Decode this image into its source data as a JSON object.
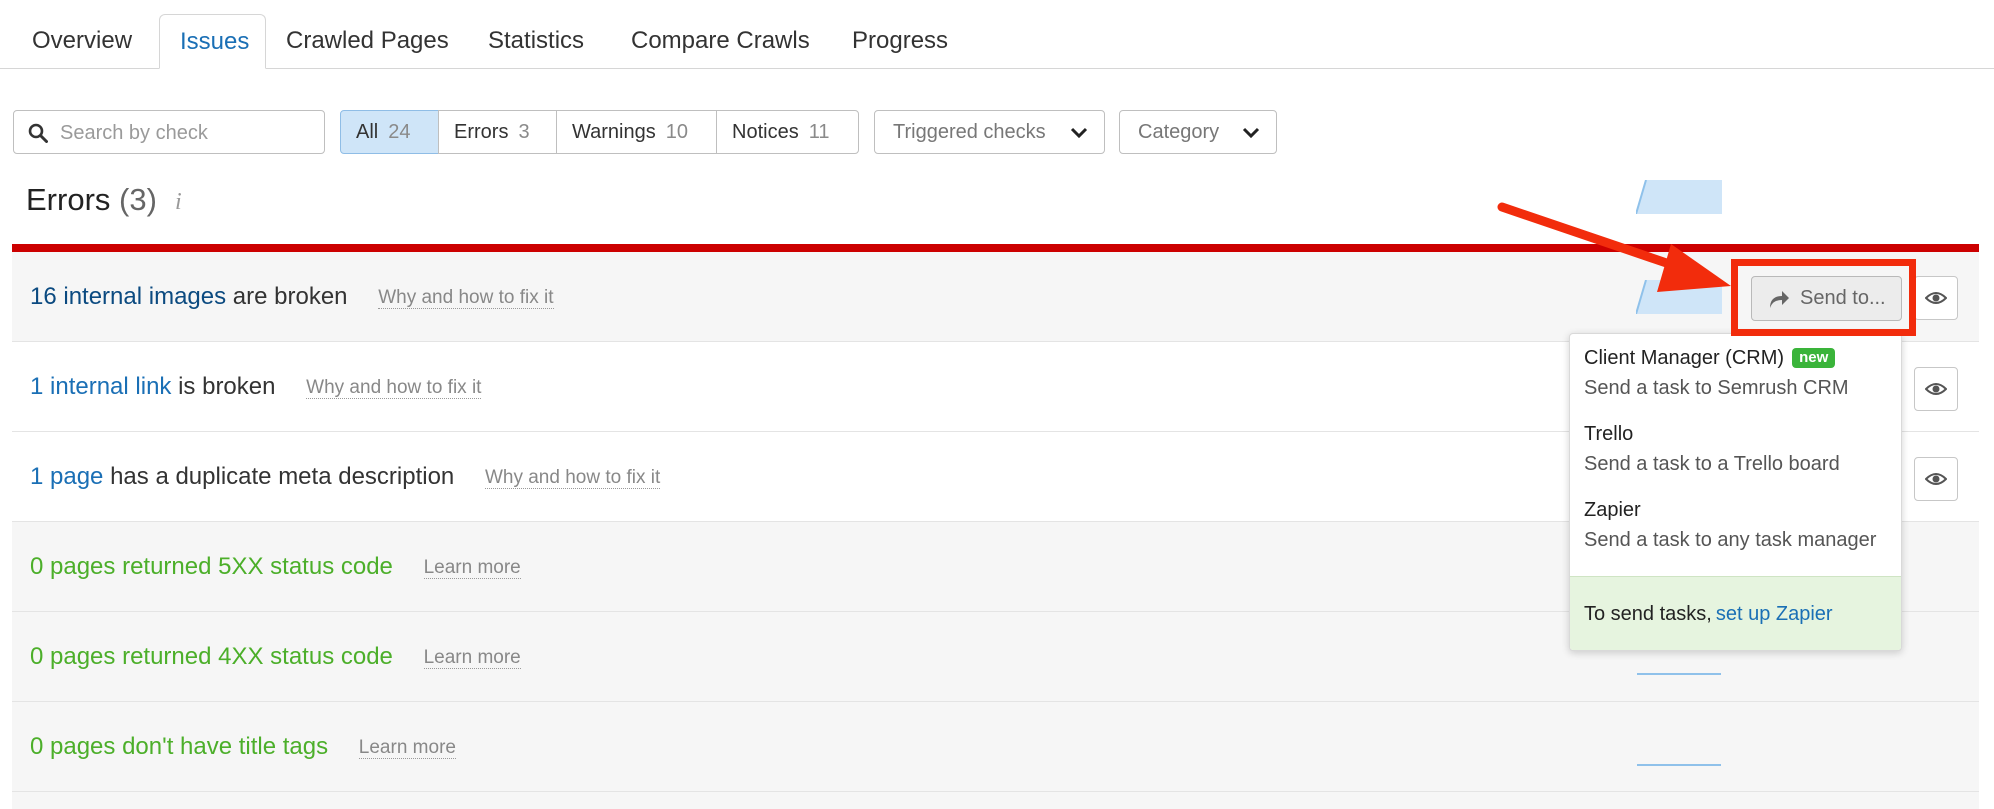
{
  "tabs": [
    "Overview",
    "Issues",
    "Crawled Pages",
    "Statistics",
    "Compare Crawls",
    "Progress"
  ],
  "active_tab": "Issues",
  "search": {
    "placeholder": "Search by check"
  },
  "filters": [
    {
      "label": "All",
      "count": "24",
      "active": true
    },
    {
      "label": "Errors",
      "count": "3"
    },
    {
      "label": "Warnings",
      "count": "10"
    },
    {
      "label": "Notices",
      "count": "11"
    }
  ],
  "dropdowns": {
    "triggered": "Triggered checks",
    "category": "Category"
  },
  "section": {
    "title": "Errors",
    "count": "(3)",
    "info": "i"
  },
  "rows": [
    {
      "link": "16 internal images",
      "rest": " are broken",
      "help": "Why and how to fix it"
    },
    {
      "link": "1 internal link",
      "rest": " is broken",
      "help": "Why and how to fix it"
    },
    {
      "link": "1 page",
      "rest": " has a duplicate meta description",
      "help": "Why and how to fix it"
    },
    {
      "text": "0 pages returned 5XX status code",
      "help": "Learn more"
    },
    {
      "text": "0 pages returned 4XX status code",
      "help": "Learn more"
    },
    {
      "text": "0 pages don't have title tags",
      "help": "Learn more"
    }
  ],
  "send_button": "Send to...",
  "send_menu": {
    "items": [
      {
        "title": "Client Manager (CRM)",
        "badge": "new",
        "desc": "Send a task to Semrush CRM"
      },
      {
        "title": "Trello",
        "desc": "Send a task to a Trello board"
      },
      {
        "title": "Zapier",
        "desc": "Send a task to any task manager"
      }
    ],
    "footer_text": "To send tasks,",
    "footer_link": "set up Zapier"
  },
  "colors": {
    "accent": "#1a6fb5",
    "error_bar": "#cc0000",
    "success": "#4caf2a",
    "annotation": "#f22c0c"
  },
  "icons": [
    "search-icon",
    "chevron-down-icon",
    "info-icon",
    "share-arrow-icon",
    "eye-icon",
    "annotation-arrow"
  ]
}
